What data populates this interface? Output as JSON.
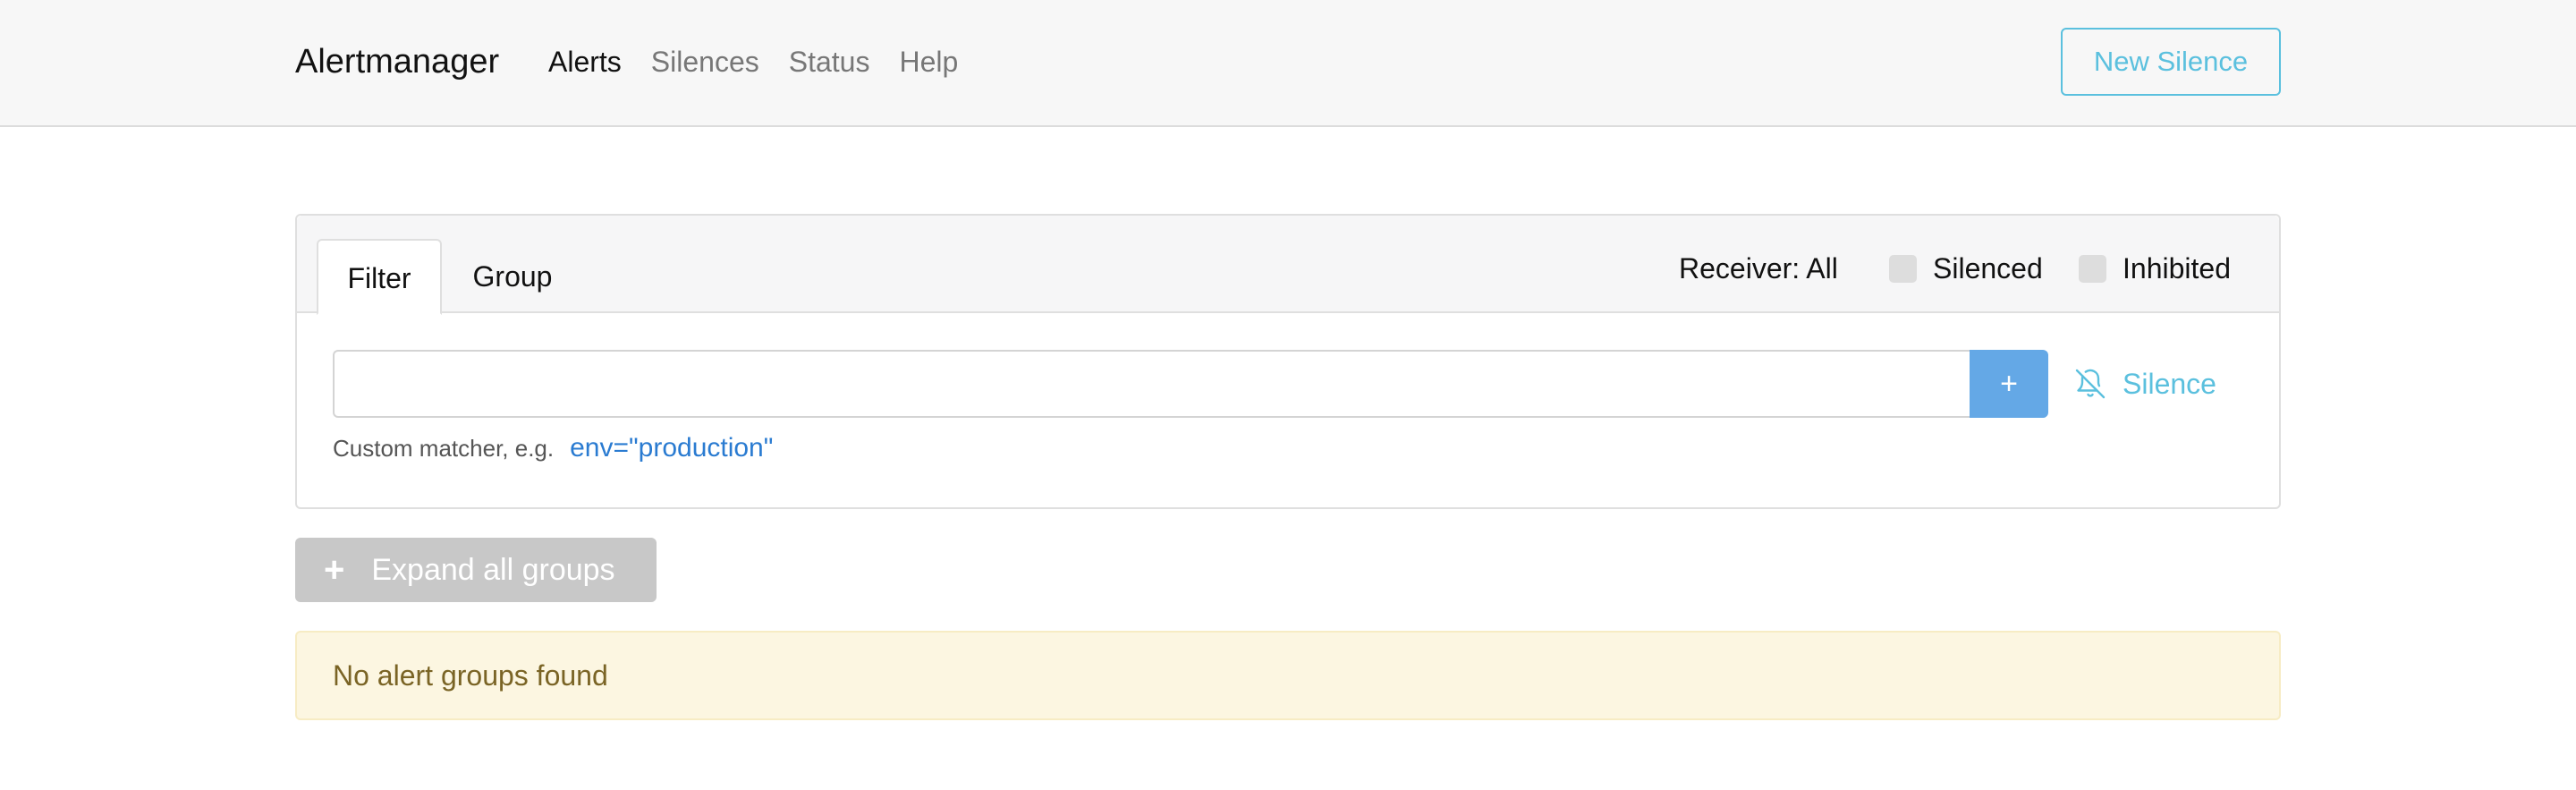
{
  "navbar": {
    "brand": "Alertmanager",
    "links": [
      {
        "label": "Alerts",
        "active": true
      },
      {
        "label": "Silences",
        "active": false
      },
      {
        "label": "Status",
        "active": false
      },
      {
        "label": "Help",
        "active": false
      }
    ],
    "new_silence_label": "New Silence"
  },
  "filter_card": {
    "tabs": [
      {
        "label": "Filter",
        "active": true
      },
      {
        "label": "Group",
        "active": false
      }
    ],
    "receiver_label": "Receiver: All",
    "silenced_label": "Silenced",
    "silenced_checked": false,
    "inhibited_label": "Inhibited",
    "inhibited_checked": false,
    "search_value": "",
    "search_placeholder": "",
    "add_button_label": "+",
    "silence_link_label": "Silence",
    "silence_icon": "bell-slash-icon",
    "hint_text": "Custom matcher, e.g.",
    "hint_example": "env=\"production\""
  },
  "expand_button_label": "Expand all groups",
  "alert_message": "No alert groups found",
  "colors": {
    "accent": "#5bc0de",
    "add_button": "#64a8e6",
    "link": "#2a7bd1",
    "warning_bg": "#fcf6e1",
    "warning_text": "#7a6425",
    "disabled_button": "#c8c8c8"
  }
}
